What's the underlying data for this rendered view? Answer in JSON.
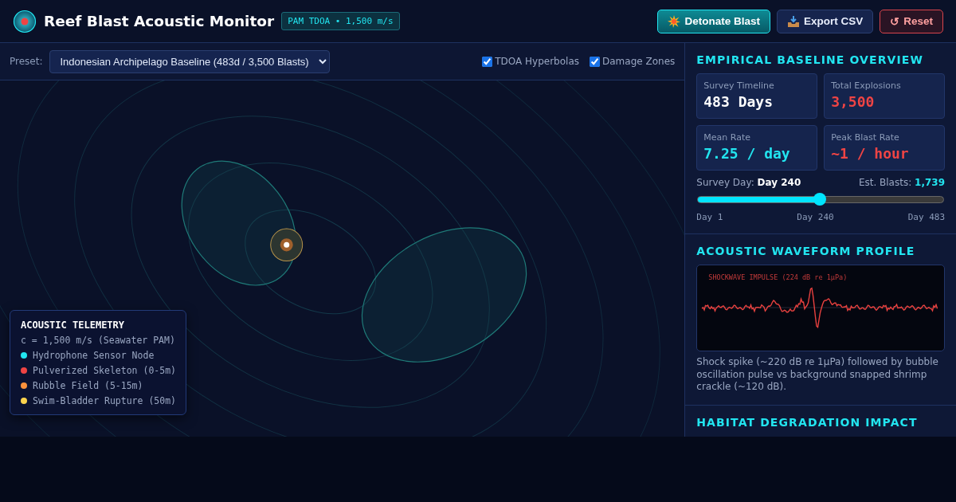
{
  "app": {
    "title": "Reef Blast Acoustic Monitor",
    "badge": "PAM TDOA • 1,500 m/s"
  },
  "actions": [
    {
      "kind": "primary",
      "label": "Detonate Blast"
    },
    {
      "kind": "export",
      "label": "Export CSV"
    },
    {
      "kind": "danger",
      "icon": "↺",
      "label": "Reset"
    }
  ],
  "toolbar": {
    "preset_label": "Preset:",
    "preset": "Indonesian Archipelago Baseline (483d / 3,500 Blasts)",
    "toggles": [
      {
        "label": "TDOA Hyperbolas",
        "checked": true
      },
      {
        "label": "Damage Zones",
        "checked": true
      }
    ]
  },
  "legend": {
    "title": "ACOUSTIC TELEMETRY",
    "subtitle": "c = 1,500 m/s (Seawater PAM)",
    "items": [
      {
        "label": "Hydrophone Sensor Node",
        "color": "#22e5f0"
      },
      {
        "label": "Pulverized Skeleton (0-5m)",
        "color": "#ef4444"
      },
      {
        "label": "Rubble Field (5-15m)",
        "color": "#fb923c"
      },
      {
        "label": "Swim-Bladder Rupture (50m)",
        "color": "#fcd34d"
      }
    ]
  },
  "overview": {
    "title": "EMPIRICAL BASELINE OVERVIEW",
    "stats": [
      {
        "label": "Survey Timeline",
        "value": "483 Days",
        "color": "#ffffff"
      },
      {
        "label": "Total Explosions",
        "value": "3,500",
        "color": "#ef4444"
      },
      {
        "label": "Mean Rate",
        "value": "7.25 / day",
        "color": "#22e5f0"
      },
      {
        "label": "Peak Blast Rate",
        "value": "~1 / hour",
        "color": "#ef4444"
      }
    ],
    "day": "Survey Day: **Day 240**",
    "blasts": "Est. Blasts: **1,739**",
    "slider": {
      "level": 0.497
    },
    "ticks": [
      "Day 1",
      "Day 240",
      "Day 483"
    ]
  },
  "waveform": {
    "title": "ACOUSTIC WAVEFORM PROFILE",
    "trace_label": "SHOCKWAVE IMPULSE (224 dB re 1µPa)",
    "caption": "Shock spike (~220 dB re 1µPa) followed by bubble oscillation pulse vs background snapped shrimp crackle (~120 dB)."
  },
  "habitat": {
    "title": "HABITAT DEGRADATION IMPACT"
  }
}
